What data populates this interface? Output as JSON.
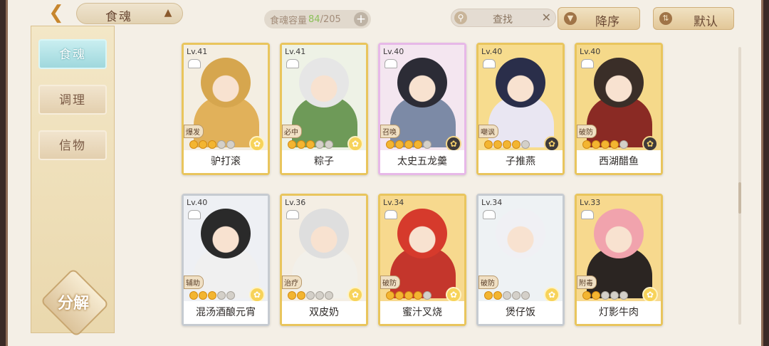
{
  "header": {
    "title": "食魂",
    "capacity_label": "食魂容量",
    "capacity_current": "84",
    "capacity_max": "/205",
    "plus": "+",
    "search_placeholder": "查找",
    "search_clear": "✕",
    "sort_order_label": "降序",
    "sort_mode_label": "默认"
  },
  "sidebar": {
    "tabs": [
      {
        "label": "食魂",
        "active": true
      },
      {
        "label": "调理",
        "active": false
      },
      {
        "label": "信物",
        "active": false
      }
    ],
    "decompose_label": "分解"
  },
  "cards": [
    {
      "level": "Lv.41",
      "name": "驴打滚",
      "role": "爆发",
      "stars": 3,
      "tier": "gold",
      "hair": "#d6a64e",
      "outfit": "#e1b15a",
      "bg": "#f4eee2"
    },
    {
      "level": "Lv.41",
      "name": "粽子",
      "role": "必中",
      "stars": 3,
      "tier": "gold",
      "hair": "#e6e6e6",
      "outfit": "#6e9a58",
      "bg": "#eef2e6"
    },
    {
      "level": "Lv.40",
      "name": "太史五龙羹",
      "role": "召唤",
      "stars": 4,
      "tier": "rainbow",
      "hair": "#2c2c36",
      "outfit": "#7c8aa6",
      "bg": "#f4e6f0"
    },
    {
      "level": "Lv.40",
      "name": "子推燕",
      "role": "嘲讽",
      "stars": 4,
      "tier": "gold",
      "hair": "#2a2e4a",
      "outfit": "#e9e6f2",
      "bg": "#f7dc8e"
    },
    {
      "level": "Lv.40",
      "name": "西湖醋鱼",
      "role": "破防",
      "stars": 4,
      "tier": "gold",
      "hair": "#3a2e28",
      "outfit": "#8a2a24",
      "bg": "#f5d98a"
    },
    {
      "level": "Lv.40",
      "name": "混汤酒酿元宵",
      "role": "辅助",
      "stars": 3,
      "tier": "silver",
      "hair": "#2a2a2a",
      "outfit": "#f0f0f0",
      "bg": "#eef0f4"
    },
    {
      "level": "Lv.36",
      "name": "双皮奶",
      "role": "治疗",
      "stars": 2,
      "tier": "gold",
      "hair": "#dedede",
      "outfit": "#f2f0ea",
      "bg": "#f4eee4"
    },
    {
      "level": "Lv.34",
      "name": "蜜汁叉烧",
      "role": "破防",
      "stars": 4,
      "tier": "gold",
      "hair": "#d63a2c",
      "outfit": "#c4362c",
      "bg": "#f7d98e"
    },
    {
      "level": "Lv.34",
      "name": "煲仔饭",
      "role": "破防",
      "stars": 2,
      "tier": "silver",
      "hair": "#f0f0f4",
      "outfit": "#eef2f4",
      "bg": "#eef2f4"
    },
    {
      "level": "Lv.33",
      "name": "灯影牛肉",
      "role": "附毒",
      "stars": 2,
      "tier": "gold",
      "hair": "#f1a3ad",
      "outfit": "#2b2522",
      "bg": "#f7d98e"
    }
  ]
}
